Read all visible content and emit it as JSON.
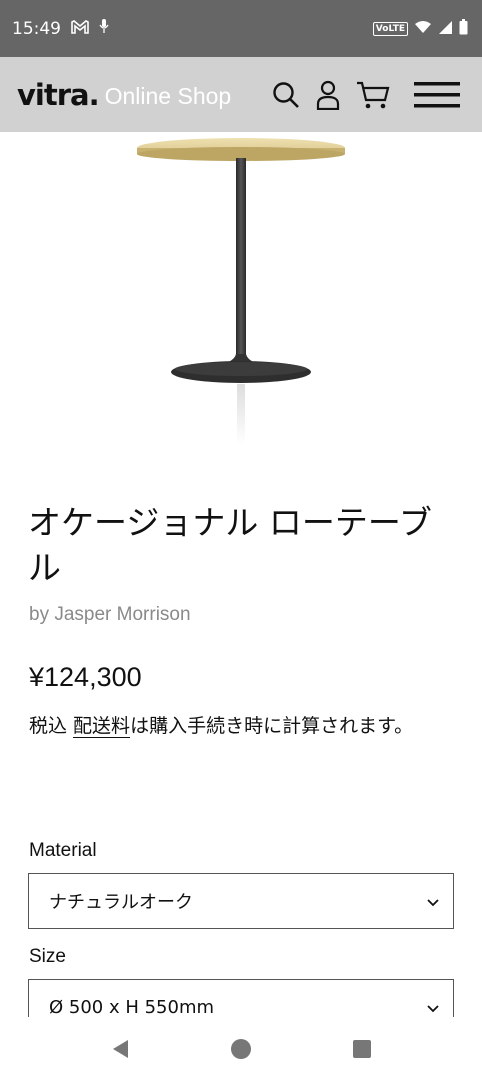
{
  "status_bar": {
    "time": "15:49",
    "volte": "VoLTE",
    "icons": [
      "gmail-icon",
      "mic-icon",
      "wifi-icon",
      "signal-icon",
      "battery-icon"
    ]
  },
  "header": {
    "logo": "vitra.",
    "shop_label": "Online Shop",
    "icons": [
      "search-icon",
      "account-icon",
      "cart-icon",
      "menu-icon"
    ]
  },
  "product": {
    "title": "オケージョナル ローテーブル",
    "designer": "by Jasper Morrison",
    "price": "¥124,300",
    "tax_prefix": "税込 ",
    "shipping_link": "配送料",
    "tax_suffix": "は購入手続き時に計算されます。"
  },
  "options": {
    "material": {
      "label": "Material",
      "value": "ナチュラルオーク"
    },
    "size": {
      "label": "Size",
      "value": "Ø 500 x H 550mm"
    }
  },
  "colors": {
    "status_bar": "#666666",
    "header_bg": "#d1d1d1",
    "tabletop": "#e6d49a",
    "metal": "#3a3a3a"
  }
}
